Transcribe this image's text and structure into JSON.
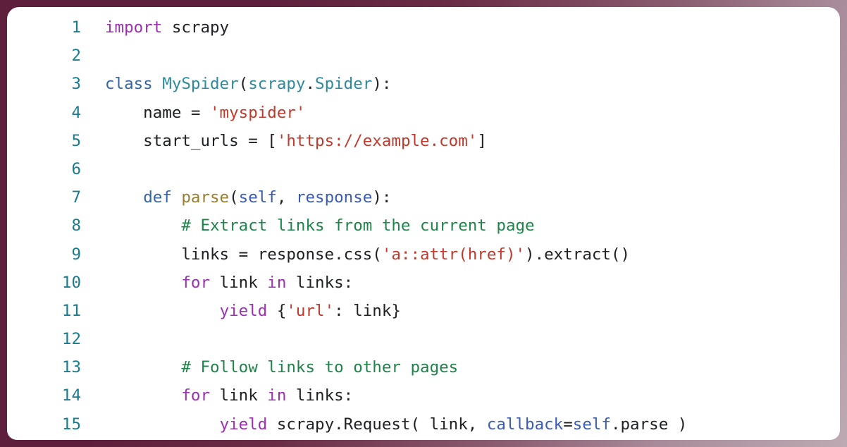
{
  "frame": {
    "gradient_from": "#5e1f3c",
    "gradient_to": "#bcaab2",
    "card_background": "#ffffff"
  },
  "theme": {
    "linenumber_color": "#1b7b8e",
    "keyword_color": "#9b30b0",
    "declaration_color": "#3465a4",
    "classname_color": "#2d8a9e",
    "function_color": "#9a7d2e",
    "parameter_color": "#3b5bb5",
    "string_color": "#c0392b",
    "comment_color": "#1e8449",
    "plain_color": "#202124"
  },
  "code": {
    "language": "python",
    "line_count": 15,
    "plain_text": "import scrapy\n\nclass MySpider(scrapy.Spider):\n    name = 'myspider'\n    start_urls = ['https://example.com']\n\n    def parse(self, response):\n        # Extract links from the current page\n        links = response.css('a::attr(href)').extract()\n        for link in links:\n            yield {'url': link}\n\n        # Follow links to other pages\n        for link in links:\n            yield scrapy.Request( link, callback=self.parse )",
    "lines": [
      {
        "number": "1",
        "text": "import scrapy",
        "tokens": [
          {
            "t": "import",
            "c": "t-kw"
          },
          {
            "t": " scrapy",
            "c": "t-plain"
          }
        ]
      },
      {
        "number": "2",
        "text": "",
        "tokens": []
      },
      {
        "number": "3",
        "text": "class MySpider(scrapy.Spider):",
        "tokens": [
          {
            "t": "class",
            "c": "t-def"
          },
          {
            "t": " ",
            "c": "t-plain"
          },
          {
            "t": "MySpider",
            "c": "t-cls"
          },
          {
            "t": "(",
            "c": "t-plain"
          },
          {
            "t": "scrapy",
            "c": "t-cls"
          },
          {
            "t": ".",
            "c": "t-plain"
          },
          {
            "t": "Spider",
            "c": "t-cls"
          },
          {
            "t": "):",
            "c": "t-plain"
          }
        ]
      },
      {
        "number": "4",
        "text": "    name = 'myspider'",
        "tokens": [
          {
            "t": "    name = ",
            "c": "t-plain"
          },
          {
            "t": "'myspider'",
            "c": "t-str"
          }
        ]
      },
      {
        "number": "5",
        "text": "    start_urls = ['https://example.com']",
        "tokens": [
          {
            "t": "    start_urls = [",
            "c": "t-plain"
          },
          {
            "t": "'https://example.com'",
            "c": "t-str"
          },
          {
            "t": "]",
            "c": "t-plain"
          }
        ]
      },
      {
        "number": "6",
        "text": "",
        "tokens": []
      },
      {
        "number": "7",
        "text": "    def parse(self, response):",
        "tokens": [
          {
            "t": "    ",
            "c": "t-plain"
          },
          {
            "t": "def",
            "c": "t-def"
          },
          {
            "t": " ",
            "c": "t-plain"
          },
          {
            "t": "parse",
            "c": "t-fn"
          },
          {
            "t": "(",
            "c": "t-plain"
          },
          {
            "t": "self",
            "c": "t-param"
          },
          {
            "t": ", ",
            "c": "t-plain"
          },
          {
            "t": "response",
            "c": "t-param"
          },
          {
            "t": "):",
            "c": "t-plain"
          }
        ]
      },
      {
        "number": "8",
        "text": "        # Extract links from the current page",
        "tokens": [
          {
            "t": "        ",
            "c": "t-plain"
          },
          {
            "t": "# Extract links from the current page",
            "c": "t-com"
          }
        ]
      },
      {
        "number": "9",
        "text": "        links = response.css('a::attr(href)').extract()",
        "tokens": [
          {
            "t": "        links = response.css(",
            "c": "t-plain"
          },
          {
            "t": "'a::attr(href)'",
            "c": "t-str"
          },
          {
            "t": ").extract()",
            "c": "t-plain"
          }
        ]
      },
      {
        "number": "10",
        "text": "        for link in links:",
        "tokens": [
          {
            "t": "        ",
            "c": "t-plain"
          },
          {
            "t": "for",
            "c": "t-kw"
          },
          {
            "t": " link ",
            "c": "t-plain"
          },
          {
            "t": "in",
            "c": "t-kw"
          },
          {
            "t": " links:",
            "c": "t-plain"
          }
        ]
      },
      {
        "number": "11",
        "text": "            yield {'url': link}",
        "tokens": [
          {
            "t": "            ",
            "c": "t-plain"
          },
          {
            "t": "yield",
            "c": "t-kw"
          },
          {
            "t": " {",
            "c": "t-plain"
          },
          {
            "t": "'url'",
            "c": "t-str"
          },
          {
            "t": ": link}",
            "c": "t-plain"
          }
        ]
      },
      {
        "number": "12",
        "text": "",
        "tokens": []
      },
      {
        "number": "13",
        "text": "        # Follow links to other pages",
        "tokens": [
          {
            "t": "        ",
            "c": "t-plain"
          },
          {
            "t": "# Follow links to other pages",
            "c": "t-com"
          }
        ]
      },
      {
        "number": "14",
        "text": "        for link in links:",
        "tokens": [
          {
            "t": "        ",
            "c": "t-plain"
          },
          {
            "t": "for",
            "c": "t-kw"
          },
          {
            "t": " link ",
            "c": "t-plain"
          },
          {
            "t": "in",
            "c": "t-kw"
          },
          {
            "t": " links:",
            "c": "t-plain"
          }
        ]
      },
      {
        "number": "15",
        "text": "            yield scrapy.Request( link, callback=self.parse )",
        "tokens": [
          {
            "t": "            ",
            "c": "t-plain"
          },
          {
            "t": "yield",
            "c": "t-kw"
          },
          {
            "t": " scrapy.Request( link, ",
            "c": "t-plain"
          },
          {
            "t": "callback",
            "c": "t-param"
          },
          {
            "t": "=",
            "c": "t-plain"
          },
          {
            "t": "self",
            "c": "t-param"
          },
          {
            "t": ".parse )",
            "c": "t-plain"
          }
        ]
      }
    ]
  }
}
